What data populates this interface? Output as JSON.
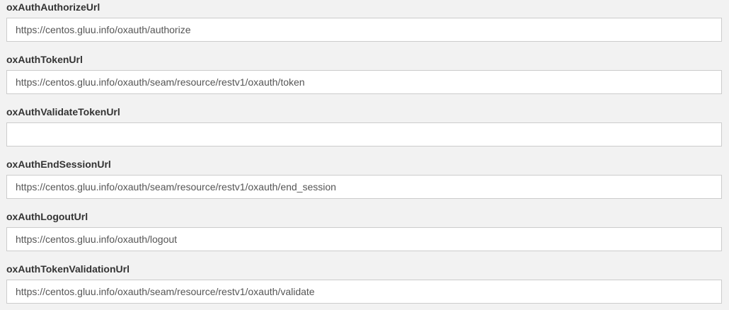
{
  "fields": [
    {
      "label": "oxAuthAuthorizeUrl",
      "value": "https://centos.gluu.info/oxauth/authorize"
    },
    {
      "label": "oxAuthTokenUrl",
      "value": "https://centos.gluu.info/oxauth/seam/resource/restv1/oxauth/token"
    },
    {
      "label": "oxAuthValidateTokenUrl",
      "value": ""
    },
    {
      "label": "oxAuthEndSessionUrl",
      "value": "https://centos.gluu.info/oxauth/seam/resource/restv1/oxauth/end_session"
    },
    {
      "label": "oxAuthLogoutUrl",
      "value": "https://centos.gluu.info/oxauth/logout"
    },
    {
      "label": "oxAuthTokenValidationUrl",
      "value": "https://centos.gluu.info/oxauth/seam/resource/restv1/oxauth/validate"
    }
  ]
}
